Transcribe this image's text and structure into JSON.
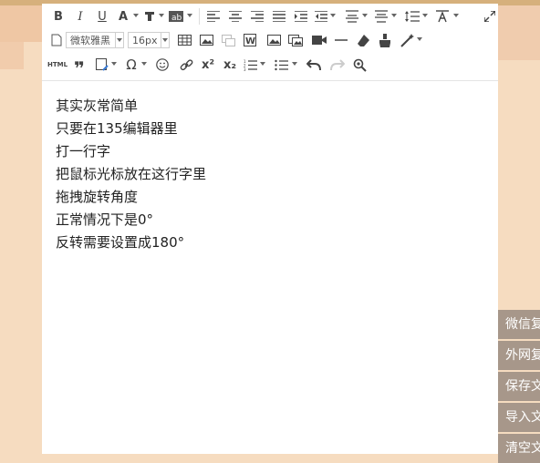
{
  "toolbar": {
    "font_family_value": "微软雅黑",
    "font_size_value": "16px",
    "html_label": "HTML",
    "buttons": {
      "bold": "B",
      "italic": "I",
      "underline": "U",
      "font_color": "A",
      "superscript": "x²",
      "subscript": "x₂",
      "omega": "Ω"
    }
  },
  "document": {
    "lines": [
      "其实灰常简单",
      "只要在135编辑器里",
      "打一行字",
      "把鼠标光标放在这行字里",
      "拖拽旋转角度",
      "正常情况下是0°",
      "反转需要设置成180°"
    ]
  },
  "side_actions": [
    {
      "label": "微信复制"
    },
    {
      "label": "外网复制"
    },
    {
      "label": "保存文章"
    },
    {
      "label": "导入文章"
    },
    {
      "label": "清空文章"
    }
  ],
  "colors": {
    "side_button_bg": "#a7978a",
    "page_bg": "#f6dcc0"
  }
}
